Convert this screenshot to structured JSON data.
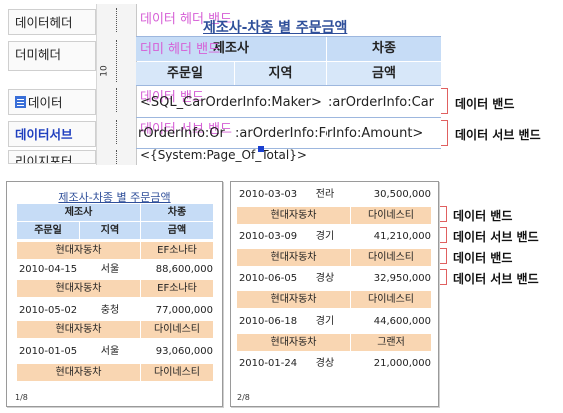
{
  "designer": {
    "bands": [
      {
        "label": "데이터헤더",
        "active": false
      },
      {
        "label": "더미헤더",
        "active": false
      },
      {
        "label": "데이터",
        "active": false
      },
      {
        "label": "데이터서브",
        "active": true
      },
      {
        "label": "리이지포터",
        "active": false
      }
    ],
    "ruler_number": "10",
    "ghost_labels": {
      "data_header": "데이터 헤더 밴드",
      "dummy_header": "더미 헤더 밴드",
      "data": "데이터 밴드",
      "data_sub": "데이터 서브 밴드"
    },
    "report_title": "제조사-차종 별 주문금액",
    "header_row1": {
      "maker": "제조사",
      "model": "차종"
    },
    "header_row2": {
      "date": "주문일",
      "region": "지역",
      "amount": "금액"
    },
    "data_band_fields": {
      "maker": "<SQL_CarOrderInfo:Maker>",
      "model": ":arOrderInfo:Car"
    },
    "sub_band_fields": {
      "order": "rOrderInfo:Or",
      "region": ":arOrderInfo:Fe",
      "amount": "rInfo:Amount>"
    },
    "footer_field": "<{System:Page_Of_Total}>",
    "band_notes": {
      "data": "데이터 밴드",
      "sub": "데이터 서브 밴드"
    }
  },
  "preview": {
    "page1": {
      "title": "제조사-차종 별 주문금액",
      "header1": {
        "maker": "제조사",
        "model": "차종"
      },
      "header2": {
        "date": "주문일",
        "region": "지역",
        "amount": "금액"
      },
      "groups": [
        {
          "maker": "현대자동차",
          "model": "EF소나타",
          "date": "2010-04-15",
          "region": "서울",
          "amount": "88,600,000"
        },
        {
          "maker": "현대자동차",
          "model": "EF소나타",
          "date": "2010-05-02",
          "region": "충청",
          "amount": "77,000,000"
        },
        {
          "maker": "현대자동차",
          "model": "다이네스티",
          "date": "2010-01-05",
          "region": "서울",
          "amount": "93,060,000"
        },
        {
          "maker": "현대자동차",
          "model": "다이네스티"
        }
      ],
      "page_label": "1/8"
    },
    "page2": {
      "rows": [
        {
          "kind": "sub",
          "date": "2010-03-03",
          "region": "전라",
          "amount": "30,500,000"
        },
        {
          "kind": "band",
          "maker": "현대자동차",
          "model": "다이네스티"
        },
        {
          "kind": "sub",
          "date": "2010-03-09",
          "region": "경기",
          "amount": "41,210,000"
        },
        {
          "kind": "band",
          "maker": "현대자동차",
          "model": "다이네스티"
        },
        {
          "kind": "sub",
          "date": "2010-06-05",
          "region": "경상",
          "amount": "32,950,000"
        },
        {
          "kind": "band",
          "maker": "현대자동차",
          "model": "다이네스티"
        },
        {
          "kind": "sub",
          "date": "2010-06-18",
          "region": "경기",
          "amount": "44,600,000"
        },
        {
          "kind": "band",
          "maker": "현대자동차",
          "model": "그랜저"
        },
        {
          "kind": "sub",
          "date": "2010-01-24",
          "region": "경상",
          "amount": "21,000,000"
        }
      ],
      "page_label": "2/8"
    },
    "notes": [
      "데이터 밴드",
      "데이터 서브 밴드",
      "데이터 밴드",
      "데이터 서브 밴드"
    ]
  }
}
